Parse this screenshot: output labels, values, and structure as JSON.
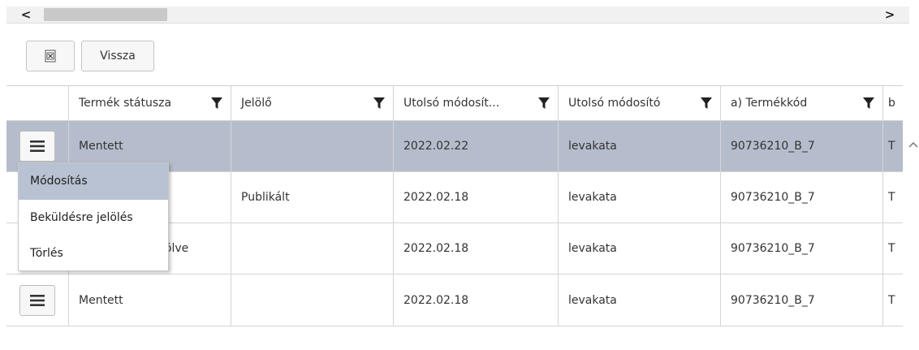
{
  "scrollbar": {
    "left_arrow": "<",
    "right_arrow": ">"
  },
  "toolbar": {
    "excel_icon": "excel-export-icon",
    "back_label": "Vissza"
  },
  "grid": {
    "columns": [
      "",
      "Termék státusza",
      "Jelölő",
      "Utolsó módosít...",
      "Utolsó módosító",
      "a) Termékkód",
      "b"
    ],
    "rows": [
      {
        "status": "Mentett",
        "marker": "",
        "modified": "2022.02.22",
        "modifier": "levakata",
        "code": "90736210_B_7",
        "extra": "T"
      },
      {
        "status": "",
        "marker": "Publikált",
        "modified": "2022.02.18",
        "modifier": "levakata",
        "code": "90736210_B_7",
        "extra": "T"
      },
      {
        "status": "lölve",
        "marker": "",
        "modified": "2022.02.18",
        "modifier": "levakata",
        "code": "90736210_B_7",
        "extra": "T"
      },
      {
        "status": "Mentett",
        "marker": "",
        "modified": "2022.02.18",
        "modifier": "levakata",
        "code": "90736210_B_7",
        "extra": "T"
      }
    ]
  },
  "context_menu": {
    "items": [
      "Módosítás",
      "Beküldésre jelölés",
      "Törlés"
    ]
  },
  "colors": {
    "selected_row": "#b5bdcc",
    "menu_active": "#b8c2d2"
  }
}
